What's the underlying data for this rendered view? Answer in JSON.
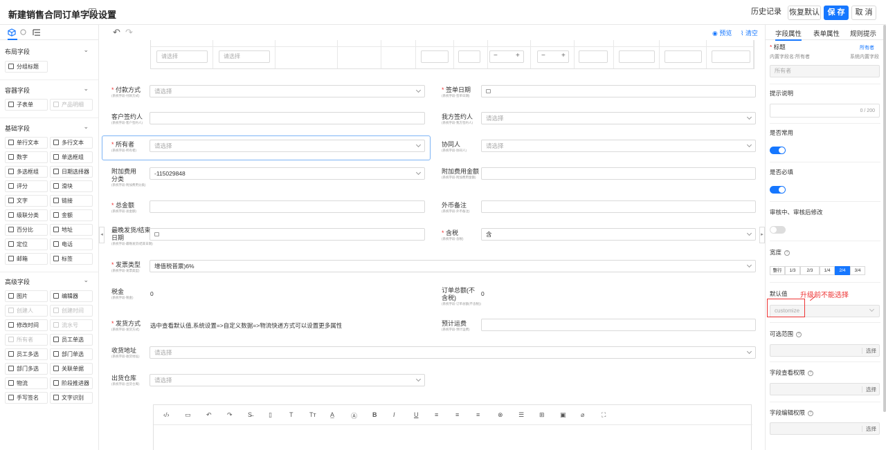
{
  "header": {
    "title": "新建销售合同订单字段设置",
    "history": "历史记录",
    "restore": "恢复默认",
    "save": "保 存",
    "cancel": "取 消"
  },
  "left_tabs": [
    "",
    ""
  ],
  "sections": {
    "layout": {
      "title": "布局字段",
      "items": [
        "分组标题"
      ]
    },
    "container": {
      "title": "容器字段",
      "items": [
        "子表单",
        "产品明细"
      ]
    },
    "basic": {
      "title": "基础字段",
      "items": [
        "单行文本",
        "多行文本",
        "数字",
        "单选框组",
        "多选框组",
        "日期选择器",
        "评分",
        "滑块",
        "文字",
        "链接",
        "级联分类",
        "金额",
        "百分比",
        "地址",
        "定位",
        "电话",
        "邮箱",
        "标签"
      ]
    },
    "advanced": {
      "title": "高级字段",
      "items": [
        "图片",
        "编辑器",
        "创建人",
        "创建时间",
        "修改时间",
        "流水号",
        "所有者",
        "员工单选",
        "员工多选",
        "部门单选",
        "部门多选",
        "关联单据",
        "物流",
        "阶段推进器",
        "手写签名",
        "文字识别"
      ]
    }
  },
  "canvas_toolbar": {
    "preview": "预览",
    "clear": "清空"
  },
  "subtable": {
    "placeholder": "请选择"
  },
  "form": {
    "payment": {
      "label": "付款方式",
      "sub": "(系统字段-付款方式)",
      "placeholder": "请选择"
    },
    "sign_date": {
      "label": "签单日期",
      "sub": "(系统字段-签单日期)"
    },
    "customer_signer": {
      "label": "客户签约人",
      "sub": "(系统字段-客户签约人)"
    },
    "our_signer": {
      "label": "我方签约人",
      "sub": "(系统字段-我方签约人)",
      "placeholder": "请选择"
    },
    "owner": {
      "label": "所有者",
      "sub": "(系统字段-所有者)",
      "placeholder": "请选择"
    },
    "collaborator": {
      "label": "协同人",
      "sub": "(系统字段-协同人)",
      "placeholder": "请选择"
    },
    "extra_fee_type": {
      "label1": "附加费用",
      "label2": "分类",
      "sub": "(系统字段-附加费用分类)",
      "value": "-115029848"
    },
    "extra_fee_amount": {
      "label": "附加费用金额",
      "sub": "(系统字段-附加费用金额)"
    },
    "total": {
      "label": "总金额",
      "sub": "(系统字段-总金额)"
    },
    "fx_note": {
      "label": "外币备注",
      "sub": "(系统字段-外币备注)"
    },
    "ship_date": {
      "label1": "最晚发货/结束",
      "label2": "日期",
      "sub": "(系统字段-最晚发货/结束日期)"
    },
    "tax_incl": {
      "label": "含税",
      "sub": "(系统字段-含税)",
      "value": "含"
    },
    "invoice_type": {
      "label": "发票类型",
      "sub": "(系统字段-发票类型)",
      "value": "增值税普票)6%"
    },
    "tax": {
      "label": "税金",
      "sub": "(系统字段-税金)",
      "value": "0"
    },
    "order_total": {
      "label1": "订单总额(不",
      "label2": "含税)",
      "sub": "(系统字段-订单总额(不含税))",
      "value": "0"
    },
    "ship_method": {
      "label": "发货方式",
      "sub": "(系统字段-发货方式)",
      "value": "选中查看默认值,系统设置=>自定义数据=>物流快递方式可以设置更多属性"
    },
    "est_freight": {
      "label": "预计运费",
      "sub": "(系统字段-预计运费)"
    },
    "ship_addr": {
      "label": "收货地址",
      "sub": "(系统字段-收货地址)",
      "placeholder": "请选择"
    },
    "warehouse": {
      "label": "出货仓库",
      "sub": "(系统字段-出货仓库)",
      "placeholder": "请选择"
    }
  },
  "right": {
    "tabs": [
      "字段属性",
      "表单属性",
      "规则提示"
    ],
    "title_label": "标题",
    "owner_link": "所有者",
    "internal_name": "内置字段名:所有者",
    "internal_type": "系统内置字段",
    "title_placeholder": "所有者",
    "hint_label": "提示说明",
    "hint_count": "0 / 200",
    "common_label": "是否常用",
    "required_label": "是否必填",
    "edit_label": "审核中、审核后修改",
    "width_label": "宽度",
    "widths": [
      "整行",
      "1/3",
      "2/3",
      "1/4",
      "2/4",
      "3/4"
    ],
    "default_label": "默认值",
    "default_value": "customize",
    "range_label": "可选范围",
    "view_perm_label": "字段查看权限",
    "edit_perm_label": "字段编辑权限",
    "pick": "选择"
  },
  "annotation": "升级前不能选择"
}
